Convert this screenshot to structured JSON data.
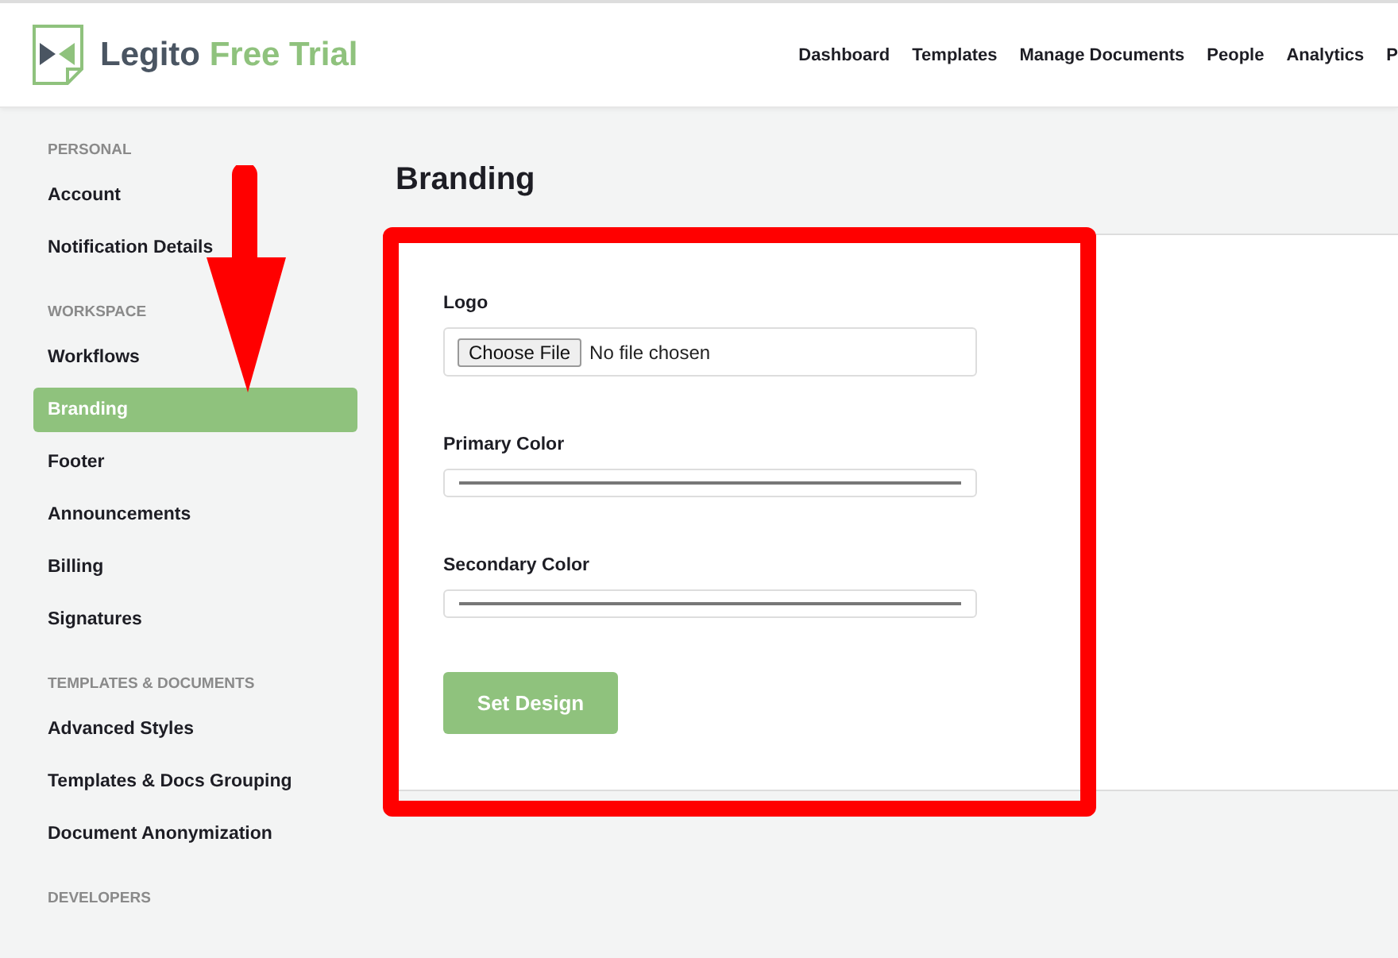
{
  "header": {
    "logo": {
      "name": "Legito",
      "suffix": "Free Trial"
    },
    "nav": [
      {
        "label": "Dashboard"
      },
      {
        "label": "Templates"
      },
      {
        "label": "Manage Documents"
      },
      {
        "label": "People"
      },
      {
        "label": "Analytics"
      },
      {
        "label": "P"
      }
    ]
  },
  "sidebar": {
    "sections": [
      {
        "title": "PERSONAL",
        "items": [
          {
            "label": "Account",
            "selected": false
          },
          {
            "label": "Notification Details",
            "selected": false
          }
        ]
      },
      {
        "title": "WORKSPACE",
        "items": [
          {
            "label": "Workflows",
            "selected": false
          },
          {
            "label": "Branding",
            "selected": true
          },
          {
            "label": "Footer",
            "selected": false
          },
          {
            "label": "Announcements",
            "selected": false
          },
          {
            "label": "Billing",
            "selected": false
          },
          {
            "label": "Signatures",
            "selected": false
          }
        ]
      },
      {
        "title": "TEMPLATES & DOCUMENTS",
        "items": [
          {
            "label": "Advanced Styles",
            "selected": false
          },
          {
            "label": "Templates & Docs Grouping",
            "selected": false
          },
          {
            "label": "Document Anonymization",
            "selected": false
          }
        ]
      },
      {
        "title": "DEVELOPERS"
      }
    ]
  },
  "page": {
    "title": "Branding",
    "fields": [
      {
        "kind": "file",
        "label": "Logo",
        "button": "Choose File",
        "status": "No file chosen"
      },
      {
        "kind": "color",
        "label": "Primary Color"
      },
      {
        "kind": "color",
        "label": "Secondary Color"
      }
    ],
    "submit": "Set Design"
  },
  "annotations": {
    "arrow": true,
    "frame": true
  }
}
